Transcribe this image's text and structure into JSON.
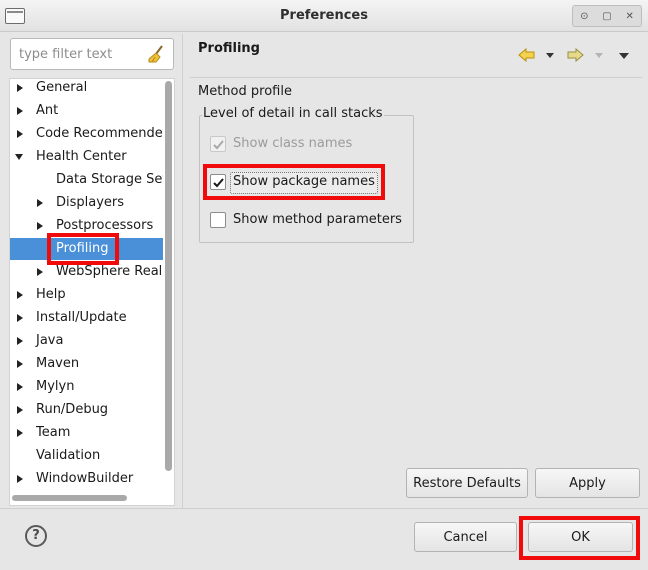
{
  "window": {
    "title": "Preferences",
    "controls": [
      "⊙",
      "▢",
      "✕"
    ]
  },
  "filter": {
    "placeholder": "type filter text"
  },
  "tree": {
    "items": [
      {
        "label": "General",
        "depth": 0,
        "state": "collapsed"
      },
      {
        "label": "Ant",
        "depth": 0,
        "state": "collapsed"
      },
      {
        "label": "Code Recommenders",
        "depth": 0,
        "state": "collapsed"
      },
      {
        "label": "Health Center",
        "depth": 0,
        "state": "expanded"
      },
      {
        "label": "Data Storage Settings",
        "depth": 1,
        "state": "leaf"
      },
      {
        "label": "Displayers",
        "depth": 1,
        "state": "collapsed"
      },
      {
        "label": "Postprocessors",
        "depth": 1,
        "state": "collapsed"
      },
      {
        "label": "Profiling",
        "depth": 1,
        "state": "leaf",
        "selected": true
      },
      {
        "label": "WebSphere Real Time",
        "depth": 1,
        "state": "collapsed"
      },
      {
        "label": "Help",
        "depth": 0,
        "state": "collapsed"
      },
      {
        "label": "Install/Update",
        "depth": 0,
        "state": "collapsed"
      },
      {
        "label": "Java",
        "depth": 0,
        "state": "collapsed"
      },
      {
        "label": "Maven",
        "depth": 0,
        "state": "collapsed"
      },
      {
        "label": "Mylyn",
        "depth": 0,
        "state": "collapsed"
      },
      {
        "label": "Run/Debug",
        "depth": 0,
        "state": "collapsed"
      },
      {
        "label": "Team",
        "depth": 0,
        "state": "collapsed"
      },
      {
        "label": "Validation",
        "depth": 0,
        "state": "leaf"
      },
      {
        "label": "WindowBuilder",
        "depth": 0,
        "state": "collapsed"
      }
    ]
  },
  "page": {
    "title": "Profiling",
    "section_label": "Method profile",
    "group_label": "Level of detail in call stacks",
    "options": [
      {
        "label": "Show class names",
        "checked": true,
        "enabled": false
      },
      {
        "label": "Show package names",
        "checked": true,
        "enabled": true
      },
      {
        "label": "Show method parameters",
        "checked": false,
        "enabled": true
      }
    ],
    "restore_defaults_label": "Restore Defaults",
    "apply_label": "Apply"
  },
  "footer": {
    "help_label": "?",
    "cancel_label": "Cancel",
    "ok_label": "OK"
  },
  "colors": {
    "selection": "#4a90d9",
    "highlight": "#f00a0a",
    "back_arrow": "#e3b40f",
    "forward_arrow": "#9a8f3f"
  }
}
